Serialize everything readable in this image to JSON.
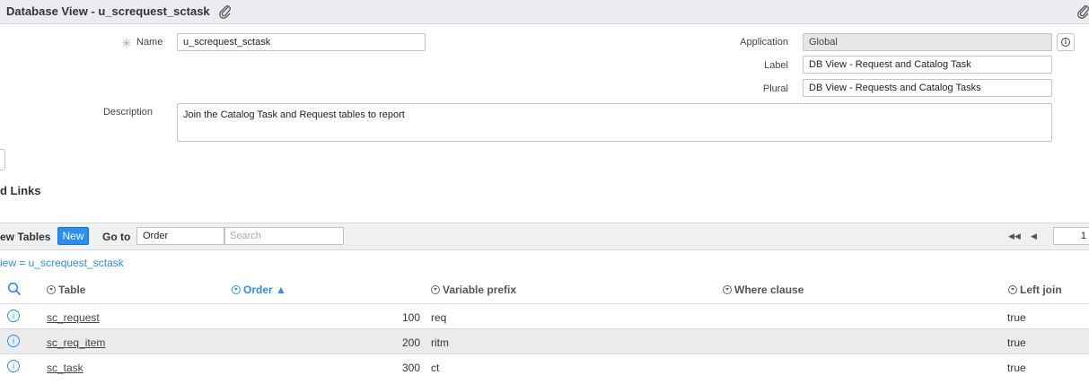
{
  "header": {
    "title": "Database View - u_screquest_sctask"
  },
  "form": {
    "name": {
      "label": "Name",
      "value": "u_screquest_sctask"
    },
    "application": {
      "label": "Application",
      "value": "Global"
    },
    "label_field": {
      "label": "Label",
      "value": "DB View - Request and Catalog Task"
    },
    "plural": {
      "label": "Plural",
      "value": "DB View - Requests and Catalog Tasks"
    },
    "description": {
      "label": "Description",
      "value": "Join the Catalog Task and Request tables to report"
    }
  },
  "related": {
    "title": "d Links"
  },
  "list": {
    "title": "ew Tables",
    "new_label": "New",
    "goto_label": "Go to",
    "goto_field": "Order",
    "search_placeholder": "Search",
    "page_number": "1",
    "breadcrumb": "iew = u_screquest_sctask",
    "columns": [
      "Table",
      "Order ▲",
      "Variable prefix",
      "Where clause",
      "Left join"
    ],
    "rows": [
      {
        "table": "sc_request",
        "order": "100",
        "prefix": "req",
        "where": "",
        "left_join": "true"
      },
      {
        "table": "sc_req_item",
        "order": "200",
        "prefix": "ritm",
        "where": "",
        "left_join": "true"
      },
      {
        "table": "sc_task",
        "order": "300",
        "prefix": "ct",
        "where": "",
        "left_join": "true"
      }
    ]
  },
  "icons": {
    "attach": "paperclip-icon",
    "info": "info-icon",
    "search": "search-icon",
    "first_page": "first-page-icon",
    "prev_page": "prev-page-icon"
  },
  "colors": {
    "accent": "#278efc",
    "header_bg": "#eaecef",
    "alt_row": "#ebebeb"
  }
}
